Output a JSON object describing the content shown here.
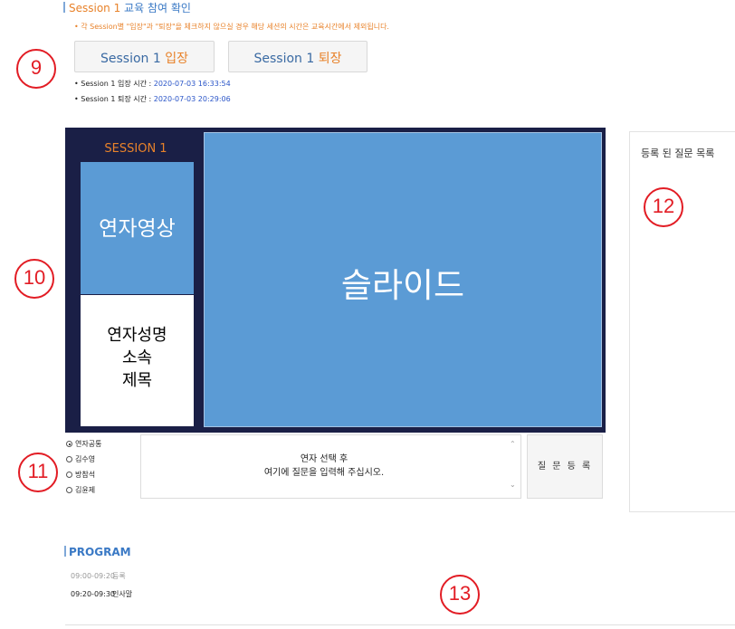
{
  "session": {
    "title_prefix": "Session 1",
    "title_rest": " 교육 참여 확인",
    "notice": "• 각 Session별 \"입장\"과 \"퇴장\"을 체크하지 않으실 경우 해당 세션의 시간은 교육시간에서 제외됩니다.",
    "enter_button": {
      "prefix": "Session 1 ",
      "accent": "입장"
    },
    "exit_button": {
      "prefix": "Session 1 ",
      "accent": "퇴장"
    },
    "enter_time": {
      "label": "• Session 1 입장 시간 : ",
      "value": "2020-07-03 16:33:54"
    },
    "exit_time": {
      "label": "• Session 1 퇴장 시간 : ",
      "value": "2020-07-03 20:29:06"
    }
  },
  "markers": [
    "9",
    "10",
    "11",
    "12",
    "13"
  ],
  "video_panel": {
    "session_label": "SESSION 1",
    "speaker_video": "연자영상",
    "speaker_info": [
      "연자성명",
      "소속",
      "제목"
    ],
    "slide": "슬라이드"
  },
  "questions": {
    "title": "등록 된 질문 목록",
    "speakers": [
      {
        "name": "연자공통",
        "selected": true
      },
      {
        "name": "김수영",
        "selected": false
      },
      {
        "name": "방참석",
        "selected": false
      },
      {
        "name": "김윤제",
        "selected": false
      }
    ],
    "placeholder_line1": "연자 선택 후",
    "placeholder_line2": "여기에 질문을 입력해 주십시오.",
    "submit_label": "질 문 등 록"
  },
  "program": {
    "title": "PROGRAM",
    "rows": [
      {
        "time": "09:00-09:20",
        "item": "등록"
      },
      {
        "time": "09:20-09:30",
        "item": "인사말"
      }
    ]
  },
  "colors": {
    "accent": "#e8822a",
    "link": "#3a79c5",
    "panel_bg": "#1a1f46",
    "video_blue": "#5b9bd5",
    "marker_red": "#e21c24"
  }
}
